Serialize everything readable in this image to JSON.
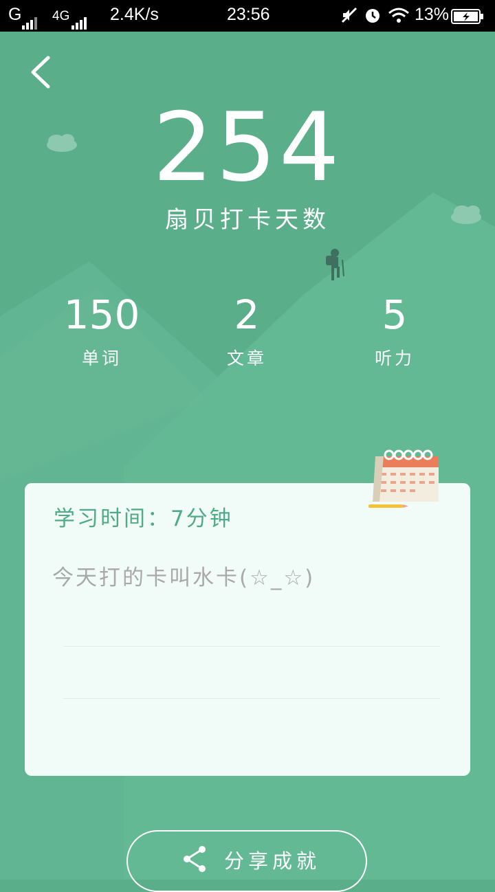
{
  "status_bar": {
    "network_1": "G",
    "network_2": "4G",
    "speed": "2.4K/s",
    "time": "23:56",
    "battery": "13%"
  },
  "header": {
    "checkin_days": "254",
    "checkin_label": "扇贝打卡天数"
  },
  "stats": [
    {
      "value": "150",
      "label": "单词"
    },
    {
      "value": "2",
      "label": "文章"
    },
    {
      "value": "5",
      "label": "听力"
    }
  ],
  "card": {
    "study_time": "学习时间：7分钟",
    "note": "今天打的卡叫水卡(☆_☆)"
  },
  "share_button": {
    "label": "分享成就"
  },
  "icons": [
    "back-arrow-icon",
    "calendar-icon",
    "share-icon",
    "mute-icon",
    "alarm-icon",
    "wifi-icon",
    "battery-icon"
  ],
  "colors": {
    "background": "#5aae8a",
    "card": "#f1fbf7",
    "accent_text": "#4faa86"
  }
}
